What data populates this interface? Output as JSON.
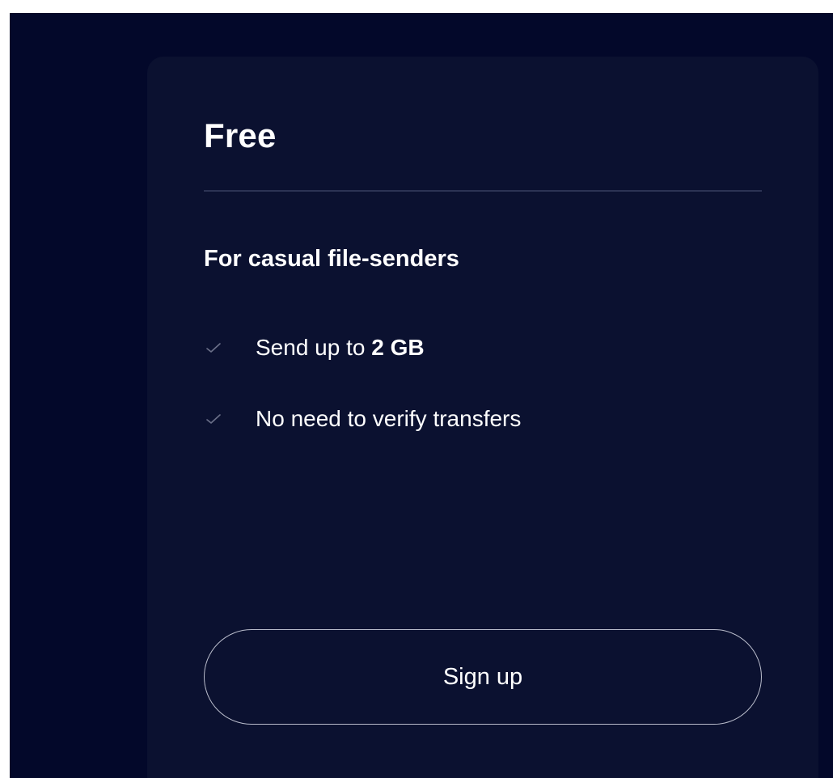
{
  "plan": {
    "title": "Free",
    "subtitle": "For casual file-senders",
    "features": [
      {
        "icon": "check-icon",
        "text_prefix": "Send up to ",
        "text_bold": "2 GB"
      },
      {
        "icon": "check-icon",
        "text_prefix": "No need to verify transfers",
        "text_bold": ""
      }
    ],
    "cta_label": "Sign up"
  },
  "colors": {
    "page_background": "#03082a",
    "card_background": "#0b1130",
    "divider": "#2c3354",
    "check": "#6b7089",
    "button_border": "#b9bccb",
    "text": "#ffffff"
  }
}
